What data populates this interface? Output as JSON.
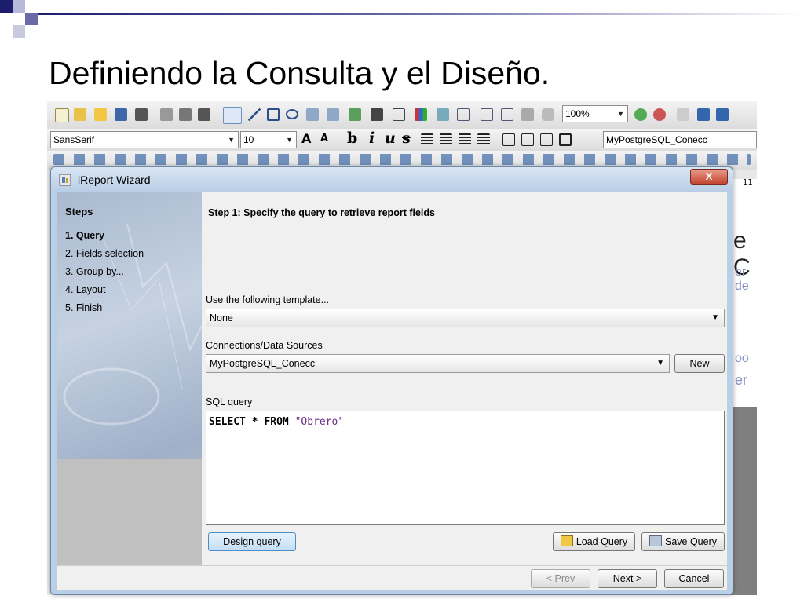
{
  "slide": {
    "title": "Definiendo la Consulta y el Diseño."
  },
  "toolbar": {
    "zoom": "100%",
    "font_family": "SansSerif",
    "font_size": "10",
    "connection": "MyPostgreSQL_Conecc",
    "format_buttons": [
      "b",
      "i",
      "u",
      "s"
    ]
  },
  "background": {
    "ruler_label": "11",
    "letters": [
      "e C",
      "er",
      "de",
      "oo",
      "er"
    ]
  },
  "dialog": {
    "title": "iReport Wizard",
    "close_label": "X",
    "steps_heading": "Steps",
    "steps": [
      {
        "label": "1. Query",
        "active": true
      },
      {
        "label": "2. Fields selection",
        "active": false
      },
      {
        "label": "3. Group by...",
        "active": false
      },
      {
        "label": "4. Layout",
        "active": false
      },
      {
        "label": "5. Finish",
        "active": false
      }
    ],
    "step_title": "Step 1: Specify the query to retrieve report fields",
    "template_label": "Use the following template...",
    "template_value": "None",
    "connections_label": "Connections/Data Sources",
    "connection_value": "MyPostgreSQL_Conecc",
    "new_button": "New",
    "sql_label": "SQL query",
    "sql": {
      "keyword1": "SELECT",
      "star": "*",
      "keyword2": "FROM",
      "table": "\"Obrero\""
    },
    "design_query_button": "Design query",
    "load_query_button": "Load Query",
    "save_query_button": "Save Query",
    "prev_button": "< Prev",
    "next_button": "Next >",
    "cancel_button": "Cancel"
  },
  "colors": {
    "deco_dark": "#1d1d6e",
    "deco_mid": "#6a6aa8",
    "deco_light": "#b8b8d8",
    "titlebar": "#b7cde5",
    "close": "#c2452f",
    "sql_string": "#6a2b86"
  }
}
